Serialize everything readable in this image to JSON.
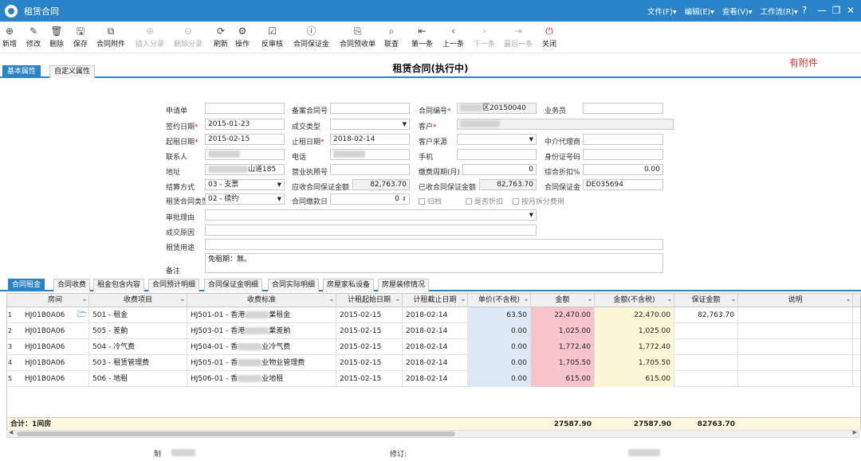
{
  "window": {
    "title": "租赁合同",
    "menus": [
      "文件(F)▾",
      "编辑(E)▾",
      "查看(V)▾",
      "工作流(R)▾"
    ],
    "help": "?",
    "min": "—",
    "restore": "❐",
    "close": "✕"
  },
  "toolbar": [
    {
      "id": "new",
      "label": "新增",
      "icon": "⊕",
      "disabled": false
    },
    {
      "id": "edit",
      "label": "修改",
      "icon": "✎",
      "disabled": false
    },
    {
      "id": "delete",
      "label": "删除",
      "icon": "🗑",
      "disabled": false
    },
    {
      "id": "save",
      "label": "保存",
      "icon": "🖫",
      "disabled": false
    },
    {
      "id": "attachment",
      "label": "合同附件",
      "icon": "⧉",
      "disabled": false
    },
    {
      "id": "insert",
      "label": "插入分录",
      "icon": "⊕",
      "disabled": true
    },
    {
      "id": "delentry",
      "label": "删除分录",
      "icon": "⊖",
      "disabled": true
    },
    {
      "id": "refresh",
      "label": "刷新",
      "icon": "⟳",
      "disabled": false
    },
    {
      "id": "ops",
      "label": "操作",
      "icon": "⚙",
      "disabled": false
    },
    {
      "id": "unaudit",
      "label": "反审核",
      "icon": "☑",
      "disabled": false
    },
    {
      "id": "deposit",
      "label": "合同保证金",
      "icon": "ⓘ",
      "disabled": false
    },
    {
      "id": "prepay",
      "label": "合同预收单",
      "icon": "⎘",
      "disabled": false
    },
    {
      "id": "query",
      "label": "联查",
      "icon": "⌕",
      "disabled": false
    },
    {
      "id": "first",
      "label": "第一条",
      "icon": "⇤",
      "disabled": false
    },
    {
      "id": "prev",
      "label": "上一条",
      "icon": "‹",
      "disabled": false
    },
    {
      "id": "next",
      "label": "下一条",
      "icon": "›",
      "disabled": true
    },
    {
      "id": "last",
      "label": "最后一条",
      "icon": "⇥",
      "disabled": true
    },
    {
      "id": "close",
      "label": "关闭",
      "icon": "⏻",
      "disabled": false
    }
  ],
  "tabs_top": [
    "基本属性",
    "自定义属性"
  ],
  "doc_title": "租赁合同(执行中)",
  "attachment_flag": "有附件",
  "form": {
    "labels": {
      "apply": "申请单",
      "record_no": "备案合同号",
      "contract_no": "合同编号",
      "salesman": "业务员",
      "sign_date": "签约日期",
      "deal_type": "成交类型",
      "customer": "客户",
      "start_date": "起租日期",
      "end_date": "止租日期",
      "cust_source": "客户来源",
      "agent": "中介代理商",
      "contact": "联系人",
      "phone": "电话",
      "mobile": "手机",
      "id_no": "身份证号码",
      "address": "地址",
      "license": "营业执照号",
      "pay_cycle": "缴费周期(月)",
      "discount": "综合折扣%",
      "settle": "结算方式",
      "deposit_due": "应收合同保证金额",
      "deposit_recv": "已收合同保证金额",
      "deposit": "合同保证金",
      "lease_type": "租赁合同类型",
      "pay_day": "合同缴款日",
      "approve_reason": "审批理由",
      "deal_reason": "成交原因",
      "usage": "租赁用途",
      "remark": "备注"
    },
    "values": {
      "contract_no": "区20150040",
      "sign_date": "2015-01-23",
      "start_date": "2015-02-15",
      "end_date": "2018-02-14",
      "address": "山道185",
      "pay_cycle": "0",
      "discount": "0.00",
      "settle": "03 - 支票",
      "deposit_due": "82,763.70",
      "deposit_recv": "82,763.70",
      "deposit": "DE035694",
      "lease_type": "02 - 续约",
      "pay_day": "0",
      "remark": "免租期：無。"
    },
    "checks": [
      "归档",
      "是否折扣",
      "按月拆分费用"
    ]
  },
  "tabs_bottom": [
    "合同租金",
    "合同收费",
    "租金包含内容",
    "合同预计明细",
    "合同保证金明细",
    "合同实际明细",
    "房屋家私设备",
    "房屋装修情况"
  ],
  "grid": {
    "headers": [
      "房间",
      "收费项目",
      "收费标准",
      "计租起始日期",
      "计租截止日期",
      "单价(不含税)",
      "金额",
      "金额(不含税)",
      "保证金额",
      "说明"
    ],
    "rows": [
      {
        "n": "1",
        "room": "HJ01B0A06",
        "item": "501 - 租金",
        "std_a": "HJ501-01 - 香港",
        "std_b": "業租金",
        "start": "2015-02-15",
        "end": "2018-02-14",
        "price": "63.50",
        "amount": "22,470.00",
        "amount_nt": "22,470.00",
        "deposit": "82,763.70",
        "note": ""
      },
      {
        "n": "2",
        "room": "HJ01B0A06",
        "item": "505 - 差餉",
        "std_a": "HJ503-01 - 香港",
        "std_b": "業差餉",
        "start": "2015-02-15",
        "end": "2018-02-14",
        "price": "0.00",
        "amount": "1,025.00",
        "amount_nt": "1,025.00",
        "deposit": "",
        "note": ""
      },
      {
        "n": "3",
        "room": "HJ01B0A06",
        "item": "504 - 冷气费",
        "std_a": "HJ504-01 - 香",
        "std_b": "业冷气费",
        "start": "2015-02-15",
        "end": "2018-02-14",
        "price": "0.00",
        "amount": "1,772.40",
        "amount_nt": "1,772.40",
        "deposit": "",
        "note": ""
      },
      {
        "n": "4",
        "room": "HJ01B0A06",
        "item": "503 - 租赁管理费",
        "std_a": "HJ505-01 - 香",
        "std_b": "业物业管理费",
        "start": "2015-02-15",
        "end": "2018-02-14",
        "price": "0.00",
        "amount": "1,705.50",
        "amount_nt": "1,705.50",
        "deposit": "",
        "note": ""
      },
      {
        "n": "5",
        "room": "HJ01B0A06",
        "item": "506 - 地租",
        "std_a": "HJ506-01 - 香",
        "std_b": "业地租",
        "start": "2015-02-15",
        "end": "2018-02-14",
        "price": "0.00",
        "amount": "615.00",
        "amount_nt": "615.00",
        "deposit": "",
        "note": ""
      }
    ],
    "totals": {
      "label": "合计：1间房",
      "amount": "27587.90",
      "amount_nt": "27587.90",
      "deposit": "82763.70"
    }
  },
  "footer": {
    "maker": "制",
    "revise": "修订:"
  },
  "colors": {
    "accent": "#2a83c9",
    "pink": "#f8c4cc",
    "blue": "#dde9f6",
    "yellow": "#fbf6d6",
    "attach_red": "#e53030"
  }
}
